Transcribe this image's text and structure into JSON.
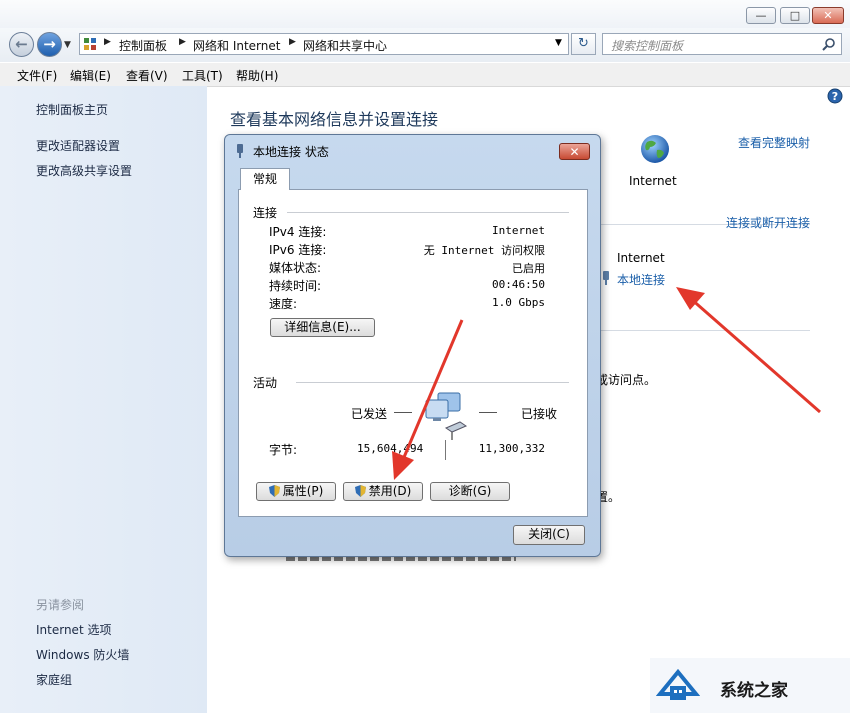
{
  "window": {
    "minimize_glyph": "—",
    "maximize_glyph": "□",
    "close_glyph": "✕"
  },
  "nav": {
    "back_glyph": "←",
    "forward_glyph": "→",
    "breadcrumbs": [
      "控制面板",
      "网络和 Internet",
      "网络和共享中心"
    ],
    "search_placeholder": "搜索控制面板",
    "refresh_glyph": "↻"
  },
  "menu": [
    "文件(F)",
    "编辑(E)",
    "查看(V)",
    "工具(T)",
    "帮助(H)"
  ],
  "sidebar": {
    "top_links": [
      "控制面板主页",
      "更改适配器设置",
      "更改高级共享设置"
    ],
    "see_also_heading": "另请参阅",
    "see_also_links": [
      "Internet 选项",
      "Windows 防火墙",
      "家庭组"
    ]
  },
  "main": {
    "title": "查看基本网络信息并设置连接",
    "view_full_map": "查看完整映射",
    "internet_label": "Internet",
    "connect_disconnect": "连接或断开连接",
    "access_type_value": "Internet",
    "connection_link": "本地连接",
    "partial_text_1": "或访问点。",
    "partial_text_2": "置。"
  },
  "dialog": {
    "title": "本地连接 状态",
    "close_glyph": "✕",
    "tab": "常规",
    "connection_group": "连接",
    "rows": [
      {
        "label": "IPv4 连接:",
        "value": "Internet"
      },
      {
        "label": "IPv6 连接:",
        "value": "无 Internet 访问权限"
      },
      {
        "label": "媒体状态:",
        "value": "已启用"
      },
      {
        "label": "持续时间:",
        "value": "00:46:50"
      },
      {
        "label": "速度:",
        "value": "1.0 Gbps"
      }
    ],
    "details_button": "详细信息(E)...",
    "activity_group": "活动",
    "sent_label": "已发送",
    "received_label": "已接收",
    "bytes_label": "字节:",
    "bytes_sent": "15,604,494",
    "bytes_received": "11,300,332",
    "properties_button": "属性(P)",
    "disable_button": "禁用(D)",
    "diagnose_button": "诊断(G)",
    "close_button": "关闭(C)"
  },
  "watermark": "系统之家",
  "colors": {
    "link": "#1b5fa9",
    "annotation_arrow": "#e2372b",
    "sidebar_bg": "#e3ecf7"
  }
}
